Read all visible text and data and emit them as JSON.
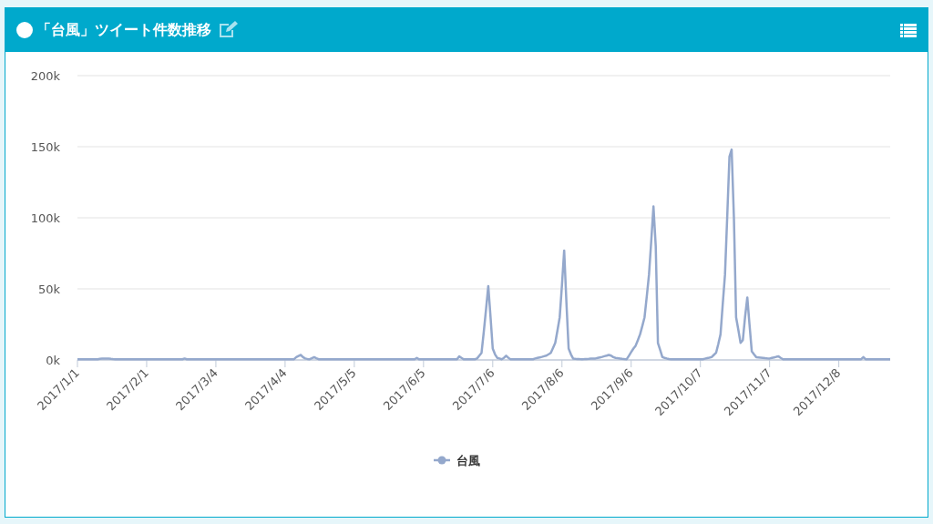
{
  "header": {
    "title": "「台風」ツイート件数推移"
  },
  "chart": {
    "chart_data": {
      "type": "line",
      "grid": true,
      "ylim": [
        0,
        200000
      ],
      "categories": [
        "2017/1/1",
        null,
        null,
        null,
        null,
        null,
        null,
        null,
        null,
        null,
        null,
        null,
        null,
        null,
        null,
        null,
        null,
        null,
        null,
        null,
        null,
        null,
        null,
        null,
        null,
        null,
        null,
        null,
        null,
        null,
        null,
        "2017/2/1",
        null,
        null,
        null,
        null,
        null,
        null,
        null,
        null,
        null,
        null,
        null,
        null,
        null,
        null,
        null,
        null,
        null,
        null,
        null,
        null,
        null,
        null,
        null,
        null,
        null,
        null,
        null,
        null,
        null,
        null,
        "2017/3/4",
        null,
        null,
        null,
        null,
        null,
        null,
        null,
        null,
        null,
        null,
        null,
        null,
        null,
        null,
        null,
        null,
        null,
        null,
        null,
        null,
        null,
        null,
        null,
        null,
        null,
        null,
        null,
        null,
        null,
        null,
        "2017/4/4",
        null,
        null,
        null,
        null,
        null,
        null,
        null,
        null,
        null,
        null,
        null,
        null,
        null,
        null,
        null,
        null,
        null,
        null,
        null,
        null,
        null,
        null,
        null,
        null,
        null,
        null,
        null,
        null,
        null,
        null,
        "2017/5/5",
        null,
        null,
        null,
        null,
        null,
        null,
        null,
        null,
        null,
        null,
        null,
        null,
        null,
        null,
        null,
        null,
        null,
        null,
        null,
        null,
        null,
        null,
        null,
        null,
        null,
        null,
        null,
        null,
        null,
        null,
        "2017/6/5",
        null,
        null,
        null,
        null,
        null,
        null,
        null,
        null,
        null,
        null,
        null,
        null,
        null,
        null,
        null,
        null,
        null,
        null,
        null,
        null,
        null,
        null,
        null,
        null,
        null,
        null,
        null,
        null,
        null,
        null,
        "2017/7/6",
        null,
        null,
        null,
        null,
        null,
        null,
        null,
        null,
        null,
        null,
        null,
        null,
        null,
        null,
        null,
        null,
        null,
        null,
        null,
        null,
        null,
        null,
        null,
        null,
        null,
        null,
        null,
        null,
        null,
        null,
        "2017/8/6",
        null,
        null,
        null,
        null,
        null,
        null,
        null,
        null,
        null,
        null,
        null,
        null,
        null,
        null,
        null,
        null,
        null,
        null,
        null,
        null,
        null,
        null,
        null,
        null,
        null,
        null,
        null,
        null,
        null,
        null,
        "2017/9/6",
        null,
        null,
        null,
        null,
        null,
        null,
        null,
        null,
        null,
        null,
        null,
        null,
        null,
        null,
        null,
        null,
        null,
        null,
        null,
        null,
        null,
        null,
        null,
        null,
        null,
        null,
        null,
        null,
        null,
        null,
        "2017/10/7",
        null,
        null,
        null,
        null,
        null,
        null,
        null,
        null,
        null,
        null,
        null,
        null,
        null,
        null,
        null,
        null,
        null,
        null,
        null,
        null,
        null,
        null,
        null,
        null,
        null,
        null,
        null,
        null,
        null,
        null,
        "2017/11/7",
        null,
        null,
        null,
        null,
        null,
        null,
        null,
        null,
        null,
        null,
        null,
        null,
        null,
        null,
        null,
        null,
        null,
        null,
        null,
        null,
        null,
        null,
        null,
        null,
        null,
        null,
        null,
        null,
        null,
        null,
        "2017/12/8",
        null,
        null,
        null,
        null,
        null,
        null,
        null,
        null,
        null,
        null,
        null,
        null,
        null,
        null,
        null,
        null,
        null,
        null,
        null,
        null,
        null,
        null,
        null
      ],
      "yticks": [
        {
          "value": 0,
          "label": "0k"
        },
        {
          "value": 50000,
          "label": "50k"
        },
        {
          "value": 100000,
          "label": "100k"
        },
        {
          "value": 150000,
          "label": "150k"
        },
        {
          "value": 200000,
          "label": "200k"
        }
      ],
      "series": [
        {
          "name": "台風",
          "color": "#94a8cc",
          "values": [
            500,
            500,
            500,
            500,
            500,
            500,
            500,
            500,
            500,
            500,
            800,
            900,
            900,
            900,
            1000,
            800,
            600,
            500,
            500,
            500,
            500,
            500,
            500,
            500,
            500,
            500,
            500,
            500,
            500,
            500,
            500,
            500,
            500,
            500,
            500,
            500,
            500,
            500,
            500,
            500,
            500,
            500,
            500,
            500,
            500,
            500,
            500,
            500,
            1000,
            500,
            500,
            500,
            500,
            500,
            500,
            500,
            500,
            500,
            500,
            500,
            500,
            500,
            500,
            500,
            500,
            500,
            500,
            500,
            500,
            500,
            500,
            500,
            500,
            500,
            500,
            500,
            500,
            500,
            500,
            500,
            500,
            500,
            500,
            500,
            500,
            500,
            500,
            500,
            500,
            500,
            500,
            500,
            500,
            500,
            500,
            500,
            500,
            500,
            2000,
            2800,
            3500,
            2000,
            1000,
            700,
            500,
            1200,
            2000,
            1200,
            500,
            500,
            500,
            500,
            500,
            500,
            500,
            500,
            500,
            500,
            500,
            500,
            500,
            500,
            500,
            500,
            500,
            500,
            500,
            500,
            500,
            500,
            500,
            500,
            500,
            500,
            500,
            500,
            500,
            500,
            500,
            500,
            500,
            500,
            500,
            500,
            500,
            500,
            500,
            500,
            500,
            500,
            500,
            500,
            1500,
            500,
            500,
            500,
            500,
            500,
            500,
            500,
            500,
            500,
            500,
            500,
            500,
            500,
            500,
            500,
            500,
            500,
            500,
            2500,
            1500,
            500,
            500,
            500,
            500,
            500,
            500,
            1000,
            3000,
            5000,
            20000,
            36000,
            52000,
            30000,
            8000,
            4000,
            1500,
            1000,
            500,
            1500,
            3000,
            1500,
            500,
            500,
            500,
            500,
            500,
            500,
            500,
            500,
            500,
            500,
            500,
            1000,
            1400,
            1800,
            2200,
            2600,
            3000,
            4000,
            5000,
            8500,
            12000,
            21000,
            30000,
            53000,
            77000,
            40000,
            8000,
            4000,
            1000,
            800,
            700,
            600,
            500,
            600,
            700,
            800,
            900,
            1000,
            1000,
            1400,
            1800,
            2200,
            2600,
            3000,
            3500,
            3000,
            2000,
            1500,
            1200,
            1000,
            800,
            600,
            500,
            3000,
            5500,
            8000,
            10000,
            14000,
            18000,
            24000,
            30000,
            45000,
            60000,
            84000,
            108000,
            80000,
            12000,
            7000,
            2000,
            1500,
            1000,
            700,
            500,
            500,
            500,
            500,
            500,
            500,
            500,
            500,
            500,
            500,
            500,
            500,
            500,
            500,
            500,
            900,
            1300,
            1600,
            2000,
            3500,
            5000,
            11000,
            18000,
            39000,
            60000,
            100000,
            143000,
            148000,
            100000,
            30000,
            21000,
            12000,
            14000,
            30000,
            44000,
            25000,
            6000,
            4000,
            2000,
            1800,
            1600,
            1400,
            1200,
            1100,
            1000,
            1400,
            1800,
            2200,
            2500,
            1500,
            500,
            500,
            500,
            500,
            500,
            500,
            500,
            500,
            500,
            500,
            500,
            500,
            500,
            500,
            500,
            500,
            500,
            500,
            500,
            500,
            500,
            500,
            500,
            500,
            500,
            500,
            500,
            500,
            500,
            500,
            500,
            500,
            500,
            500,
            500,
            500,
            2000,
            500,
            500,
            500,
            500,
            500,
            500,
            500,
            500,
            500,
            500,
            500,
            500
          ]
        }
      ]
    }
  }
}
